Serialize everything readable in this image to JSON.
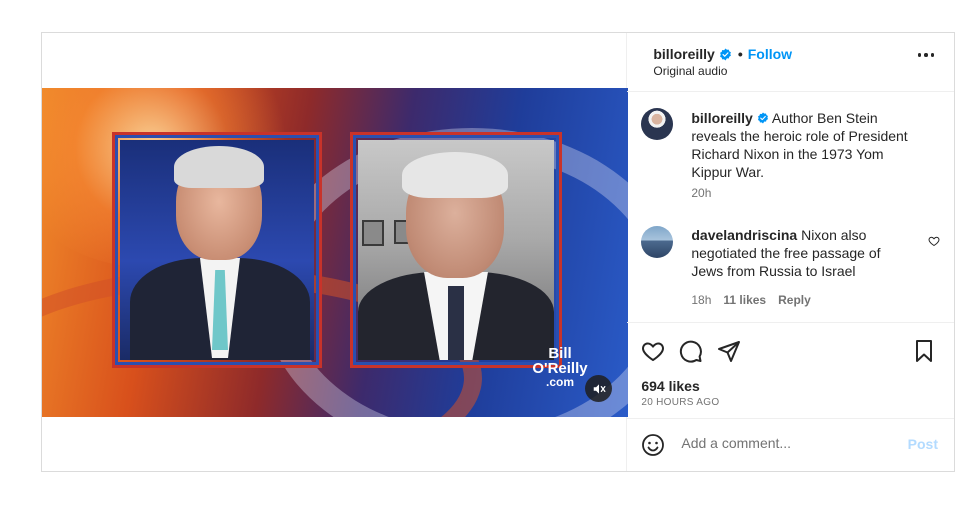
{
  "header": {
    "username": "billoreilly",
    "separator": "•",
    "follow_label": "Follow",
    "audio_label": "Original audio"
  },
  "video": {
    "logo_line1": "Bill",
    "logo_line2": "O'Reilly",
    "logo_line3": ".com",
    "muted": true
  },
  "caption": {
    "username": "billoreilly",
    "text": "Author Ben Stein reveals the heroic role of President Richard Nixon in the 1973 Yom Kippur War.",
    "time": "20h"
  },
  "comments": [
    {
      "username": "davelandriscina",
      "text": "Nixon also negotiated the free passage of Jews from Russia to Israel",
      "time": "18h",
      "likes": "11 likes",
      "reply_label": "Reply"
    }
  ],
  "actions": {
    "likes": "694 likes",
    "timestamp": "20 HOURS AGO"
  },
  "add_comment": {
    "placeholder": "Add a comment...",
    "post_label": "Post"
  },
  "colors": {
    "link_blue": "#0095f6",
    "post_disabled": "#b3dbff",
    "text": "#262626",
    "muted": "#737373"
  }
}
